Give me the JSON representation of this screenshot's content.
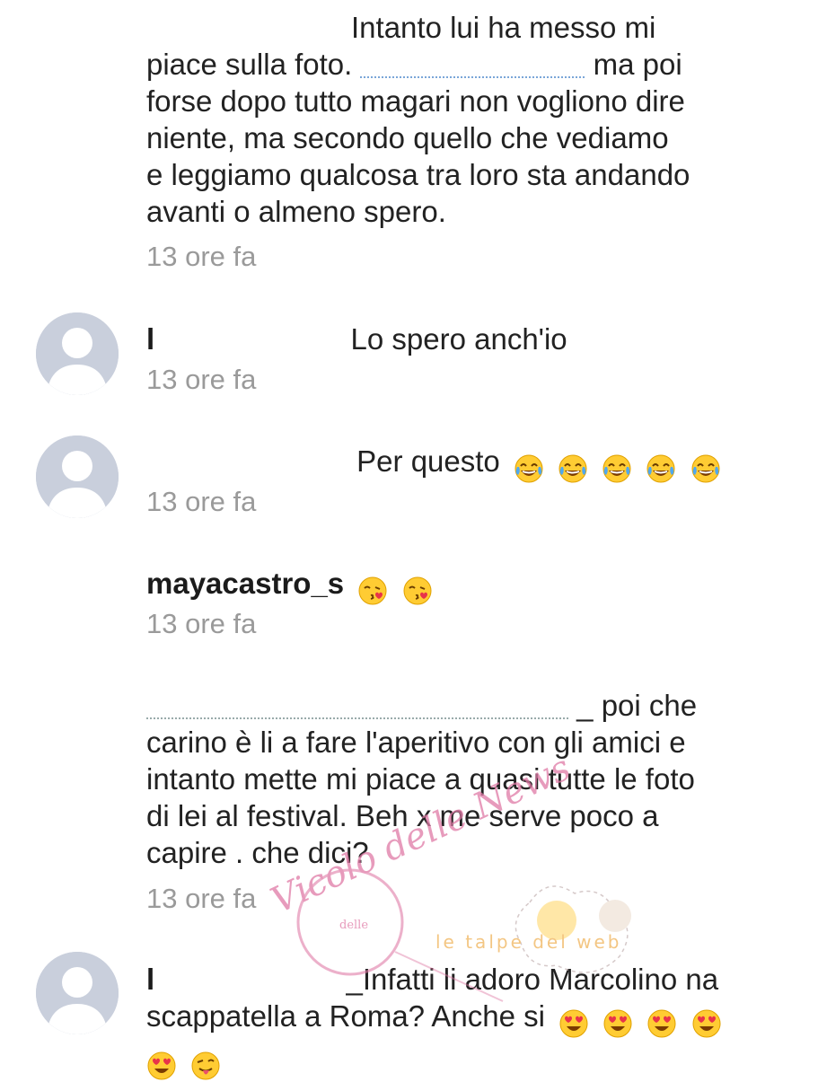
{
  "comments": [
    {
      "text_lines": [
        "Intanto lui ha messo mi",
        "piace sulla foto.",
        "ma poi",
        "forse dopo tutto magari non vogliono dire",
        "niente, ma secondo quello che vediamo",
        "e leggiamo qualcosa tra loro sta andando",
        "avanti o almeno spero."
      ],
      "time": "13 ore fa"
    },
    {
      "username": "l",
      "text": "Lo spero anch'io",
      "time": "13 ore fa"
    },
    {
      "text": "Per questo",
      "emojis": [
        "tears-of-joy",
        "tears-of-joy",
        "tears-of-joy",
        "tears-of-joy",
        "tears-of-joy"
      ],
      "time": "13 ore fa"
    },
    {
      "username": "mayacastro_s",
      "emojis": [
        "kissing-heart",
        "kissing-heart"
      ],
      "time": "13 ore fa"
    },
    {
      "text_lines": [
        "_ poi che",
        "carino è li a fare l'aperitivo con gli amici e",
        "intanto mette mi piace a quasi tutte le foto",
        "di lei al festival. Beh x me serve poco a",
        "capire . che dici?"
      ],
      "time": "13 ore fa"
    },
    {
      "username": "l",
      "text_lines": [
        "_Infatti  li adoro Marcolino  na",
        "scappatella  a Roma?  Anche si"
      ],
      "emojis_line1": [
        "heart-eyes",
        "heart-eyes",
        "heart-eyes",
        "heart-eyes"
      ],
      "emojis_line2": [
        "heart-eyes",
        "winking-tongue"
      ]
    }
  ],
  "watermark": {
    "brand": "Vicolo delle News",
    "small": "delle",
    "tagline": "le talpe del web"
  },
  "colors": {
    "time_gray": "#9a9a9a",
    "avatar_bg": "#c9cfdc",
    "watermark_pink": "#e07aa6"
  }
}
